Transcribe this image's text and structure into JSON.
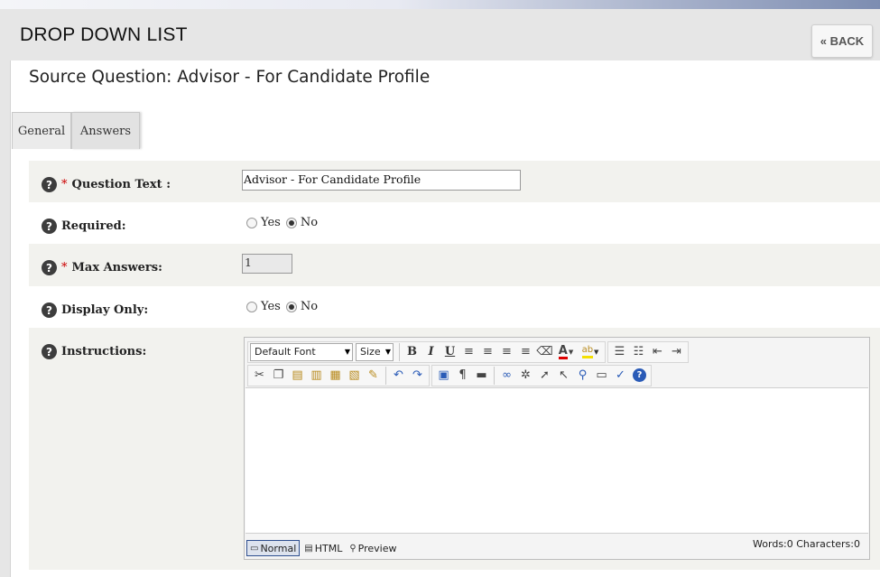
{
  "header": {
    "title": "DROP DOWN LIST",
    "back_label": "« BACK"
  },
  "source_question": "Source Question: Advisor - For Candidate Profile",
  "tabs": [
    {
      "label": "General",
      "active": true
    },
    {
      "label": "Answers",
      "active": false
    }
  ],
  "form": {
    "question_text": {
      "label": "Question Text :",
      "value": "Advisor - For Candidate Profile",
      "required": true
    },
    "required": {
      "label": "Required:",
      "options": [
        "Yes",
        "No"
      ],
      "selected": "No"
    },
    "max_answers": {
      "label": "Max Answers:",
      "value": "1",
      "required": true
    },
    "display_only": {
      "label": "Display Only:",
      "options": [
        "Yes",
        "No"
      ],
      "selected": "No"
    },
    "instructions": {
      "label": "Instructions:"
    }
  },
  "editor": {
    "font_select": "Default Font",
    "size_select": "Size",
    "modes": [
      "Normal",
      "HTML",
      "Preview"
    ],
    "active_mode": "Normal",
    "counts": "Words:0 Characters:0"
  },
  "icons": {
    "help": "?",
    "bold": "B",
    "italic": "I",
    "underline": "U"
  },
  "colors": {
    "header_bg": "#e6e6e6",
    "row_shade": "#f2f2ee",
    "required_star": "#cc0000",
    "help_icon": "#3d3d3d"
  }
}
